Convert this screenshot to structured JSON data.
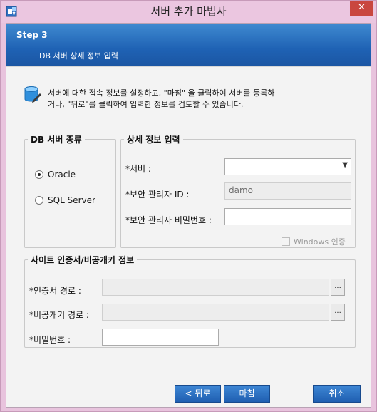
{
  "window": {
    "title": "서버 추가 마법사",
    "close_glyph": "✕"
  },
  "header": {
    "step": "Step 3",
    "subtitle": "DB 서버 상세 정보 입력"
  },
  "info": {
    "icon": "database-icon",
    "line1": "서버에 대한 접속 정보를 설정하고, \"마침\" 을 클릭하여 서버를 등록하",
    "line2": "거나, \"뒤로\"를 클릭하여 입력한 정보를 검토할 수 있습니다."
  },
  "db_type": {
    "legend": "DB 서버 종류",
    "options": [
      {
        "label": "Oracle",
        "checked": true
      },
      {
        "label": "SQL Server",
        "checked": false
      }
    ]
  },
  "detail": {
    "legend": "상세 정보 입력",
    "server_label": "*서버 :",
    "server_value": "",
    "admin_id_label": "*보안 관리자 ID :",
    "admin_id_value": "damo",
    "admin_pw_label": "*보안 관리자 비밀번호 :",
    "admin_pw_value": "",
    "windows_auth_label": "Windows 인증",
    "windows_auth_checked": false
  },
  "cert": {
    "legend": "사이트 인증서/비공개키 정보",
    "cert_path_label": "*인증서 경로 :",
    "key_path_label": "*비공개키 경로 :",
    "password_label": "*비밀번호 :",
    "browse_label": "..."
  },
  "footer": {
    "back_label": "< 뒤로",
    "finish_label": "마침",
    "cancel_label": "취소"
  },
  "colors": {
    "accent": "#1f62b4",
    "title_bar": "#ebc6e0",
    "close": "#c9473f"
  }
}
